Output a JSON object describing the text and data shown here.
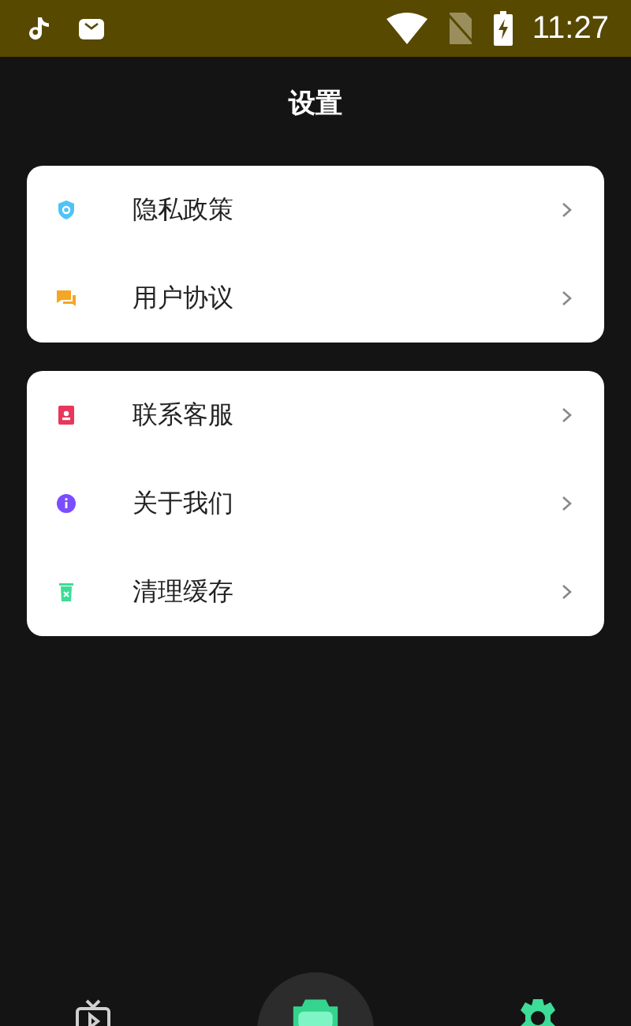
{
  "status_bar": {
    "time": "11:27"
  },
  "title": "设置",
  "groups": [
    {
      "items": [
        {
          "label": "隐私政策",
          "kind": "shield",
          "color": "#4fc3f7"
        },
        {
          "label": "用户协议",
          "kind": "chat",
          "color": "#f5a623"
        }
      ]
    },
    {
      "items": [
        {
          "label": "联系客服",
          "kind": "contact",
          "color": "#e8365d"
        },
        {
          "label": "关于我们",
          "kind": "info",
          "color": "#7c4dff"
        },
        {
          "label": "清理缓存",
          "kind": "trash",
          "color": "#3ddc97"
        }
      ]
    }
  ],
  "nav": [
    {
      "kind": "tv",
      "selected": false
    },
    {
      "kind": "camera",
      "selected": false
    },
    {
      "kind": "gear",
      "selected": true
    }
  ]
}
